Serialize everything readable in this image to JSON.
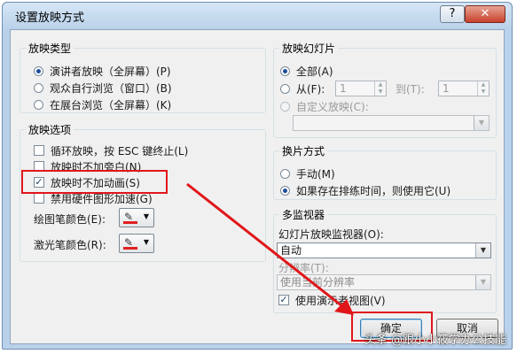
{
  "window": {
    "title": "设置放映方式",
    "help_label": "?",
    "close_label": "✕"
  },
  "show_type": {
    "legend": "放映类型",
    "options": [
      {
        "label": "演讲者放映（全屏幕）(P)",
        "checked": true
      },
      {
        "label": "观众自行浏览（窗口）(B)",
        "checked": false
      },
      {
        "label": "在展台浏览（全屏幕）(K)",
        "checked": false
      }
    ]
  },
  "show_options": {
    "legend": "放映选项",
    "checkboxes": [
      {
        "label": "循环放映，按 ESC 键终止(L)",
        "checked": false
      },
      {
        "label": "放映时不加旁白(N)",
        "checked": false
      },
      {
        "label": "放映时不加动画(S)",
        "checked": true
      },
      {
        "label": "禁用硬件图形加速(G)",
        "checked": false
      }
    ],
    "pen_color_label": "绘图笔颜色(E):",
    "laser_color_label": "激光笔颜色(R):",
    "pen_color": "#e02020",
    "laser_color": "#e02020"
  },
  "slides": {
    "legend": "放映幻灯片",
    "all_label": "全部(A)",
    "from_label": "从(F):",
    "from_value": "1",
    "to_label": "到(T):",
    "to_value": "1",
    "custom_label": "自定义放映(C):",
    "custom_value": ""
  },
  "advance": {
    "legend": "换片方式",
    "manual_label": "手动(M)",
    "timings_label": "如果存在排练时间，则使用它(U)"
  },
  "monitors": {
    "legend": "多监视器",
    "monitor_label": "幻灯片放映监视器(O):",
    "monitor_value": "自动",
    "resolution_label": "分辨率(T):",
    "resolution_value": "使用当前分辨率",
    "presenter_view_label": "使用演示者视图(V)",
    "presenter_view_checked": true
  },
  "buttons": {
    "ok": "确定",
    "cancel": "取消"
  },
  "watermark": "头条 @跟小小筱学办公技能",
  "colors": {
    "highlight": "#e0161a"
  }
}
